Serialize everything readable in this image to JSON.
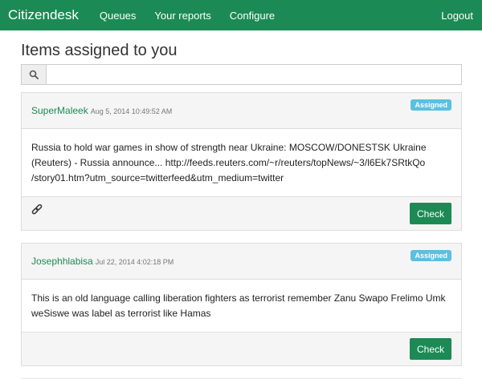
{
  "nav": {
    "brand": "Citizendesk",
    "links": [
      "Queues",
      "Your reports",
      "Configure"
    ],
    "logout": "Logout"
  },
  "page": {
    "title": "Items assigned to you"
  },
  "search": {
    "value": "",
    "placeholder": ""
  },
  "icons": {
    "search": "search-icon",
    "link": "link-icon"
  },
  "colors": {
    "brand": "#1c8a54",
    "badge": "#5bc0de"
  },
  "items": [
    {
      "author": "SuperMaleek",
      "date": "Aug 5, 2014 10:49:52 AM",
      "status": "Assigned",
      "text": "Russia to hold war games in show of strength near Ukraine: MOSCOW/DONESTSK Ukraine (Reuters) - Russia announce... http://feeds.reuters.com/~r/reuters/topNews/~3/l6Ek7SRtkQo /story01.htm?utm_source=twitterfeed&utm_medium=twitter",
      "action": "Check"
    },
    {
      "author": "Josephhlabisa",
      "date": "Jul 22, 2014 4:02:18 PM",
      "status": "Assigned",
      "text": "This is an old language calling liberation fighters as terrorist remember Zanu Swapo Frelimo Umk weSiswe was label as terrorist like Hamas",
      "action": "Check"
    }
  ]
}
